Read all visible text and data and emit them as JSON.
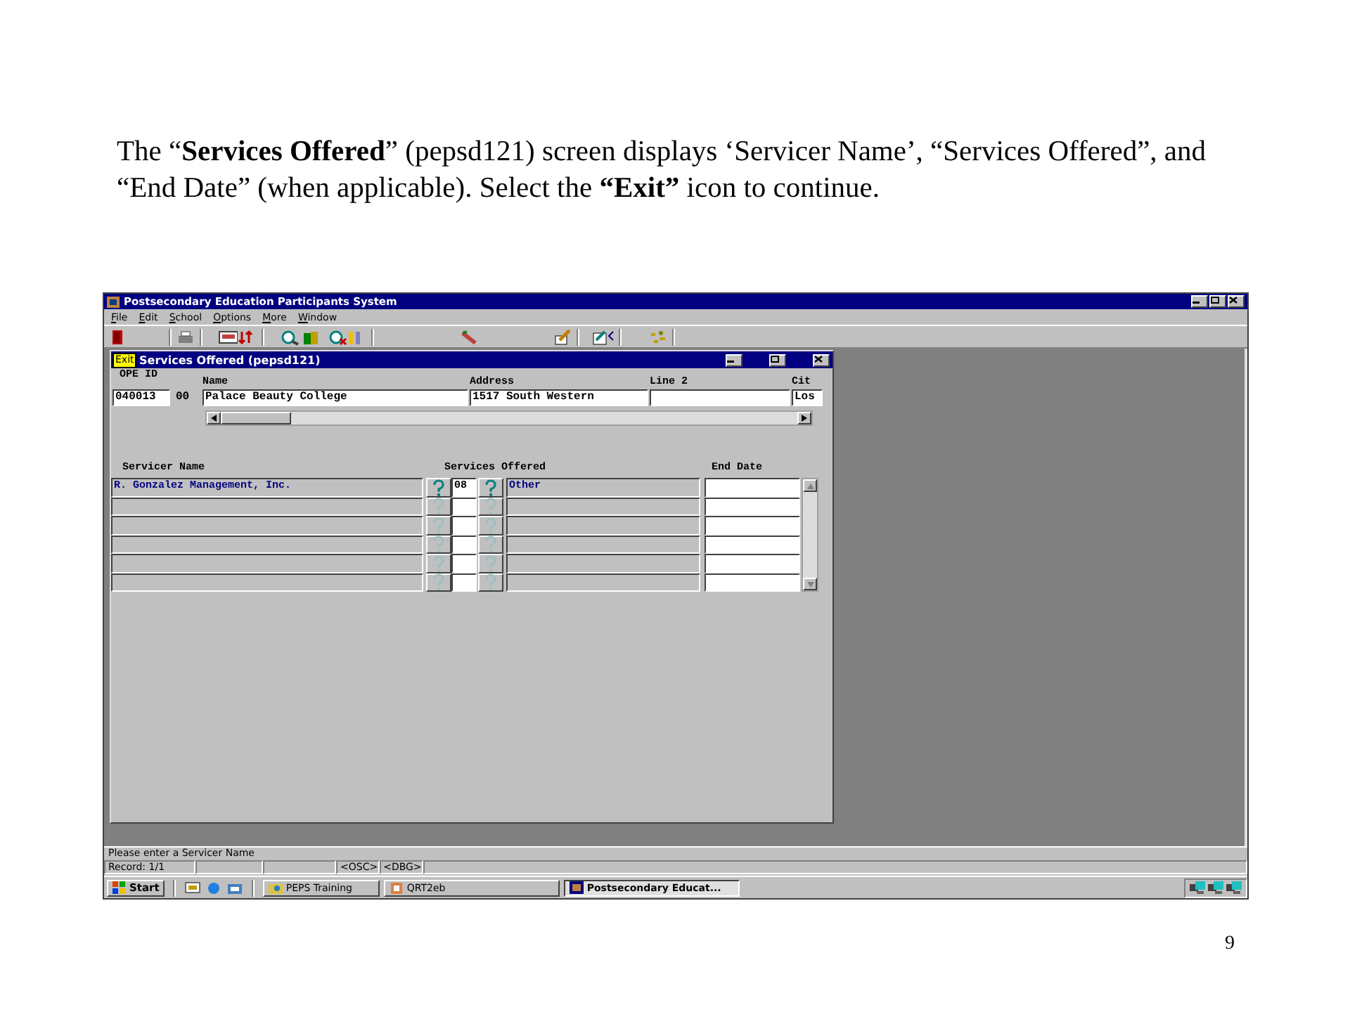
{
  "caption": "The “**Services Offered**” (pepsd121) screen displays ‘Servicer Name’, “Services Offered”,  and “End Date” (when applicable).  Select the **“Exit”** icon to continue.",
  "page_number": "9",
  "app": {
    "title": "Postsecondary Education Participants System",
    "menu": [
      "File",
      "Edit",
      "School",
      "Options",
      "More",
      "Window"
    ],
    "toolbar_tooltip": "Exit",
    "form": {
      "title": "Services Offered (pepsd121)",
      "ope_id": {
        "label": "OPE ID",
        "values": [
          "040013",
          "00"
        ]
      },
      "school_fields": [
        {
          "label": "Name",
          "value": "Palace Beauty College"
        },
        {
          "label": "Address",
          "value": "1517 South Western"
        },
        {
          "label": "Line 2"
        },
        {
          "label": "Cit",
          "value": "Los"
        }
      ],
      "grid": {
        "columns": [
          "Servicer Name",
          "Services Offered",
          "End Date"
        ],
        "rows": [
          {
            "kind": "filled",
            "servicer": "R. Gonzalez Management, Inc.",
            "code": "08",
            "service": "Other",
            "disabled": false
          },
          {
            "kind": "blank",
            "disabled": true
          },
          {
            "kind": "blank",
            "disabled": true
          },
          {
            "kind": "blank",
            "disabled": true
          },
          {
            "kind": "blank",
            "disabled": true
          },
          {
            "kind": "blank",
            "disabled": true
          }
        ]
      }
    },
    "status": {
      "message": "Please enter a Servicer Name",
      "record": "Record: 1/1",
      "flags": [
        "<OSC>",
        "<DBG>"
      ]
    },
    "taskbar": {
      "start": "Start",
      "tasks": [
        {
          "label": "PEPS Training",
          "selected": false
        },
        {
          "label": "QRT2eb",
          "selected": false
        },
        {
          "label": "Postsecondary Educat...",
          "selected": true
        }
      ]
    }
  }
}
